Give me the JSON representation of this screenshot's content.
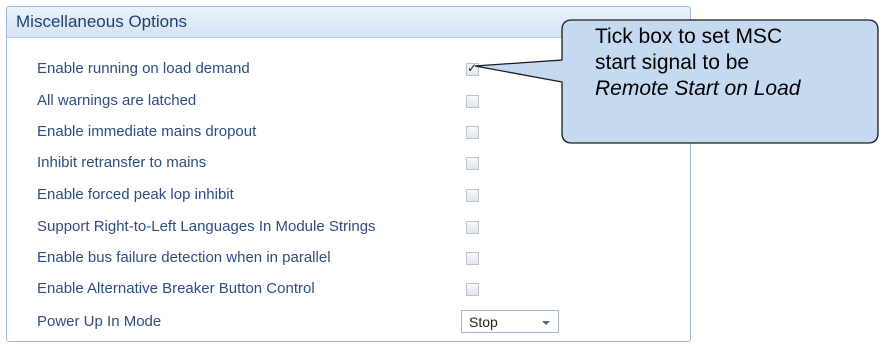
{
  "panel": {
    "title": "Miscellaneous Options",
    "options": [
      {
        "label": "Enable running on load demand",
        "checked": true
      },
      {
        "label": "All warnings are latched",
        "checked": false
      },
      {
        "label": "Enable immediate mains dropout",
        "checked": false
      },
      {
        "label": "Inhibit retransfer to mains",
        "checked": false
      },
      {
        "label": "Enable forced peak lop inhibit",
        "checked": false
      },
      {
        "label": "Support Right-to-Left Languages In Module Strings",
        "checked": false
      },
      {
        "label": "Enable bus failure detection when in parallel",
        "checked": false
      },
      {
        "label": "Enable Alternative Breaker Button Control",
        "checked": false
      }
    ],
    "power_up": {
      "label": "Power Up In Mode",
      "value": "Stop"
    }
  },
  "callout": {
    "line1": "Tick box to set MSC",
    "line2": "start signal to be",
    "line3": "Remote Start on Load"
  },
  "icons": {
    "check": "check-icon",
    "dropdown": "chevron-down-icon"
  },
  "colors": {
    "label_text": "#2c4e7e",
    "header_bg": "#dce7f5",
    "callout_fill": "#c5d9f1"
  }
}
